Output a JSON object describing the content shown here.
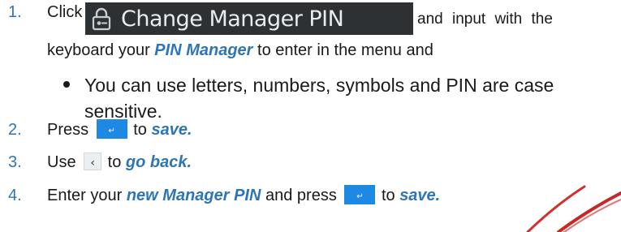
{
  "colors": {
    "accent_blue": "#2e75b6",
    "enter_button": "#1e88e5",
    "dark_button": "#2d3134",
    "red_mark": "#d32f2f"
  },
  "step1": {
    "number": "1.",
    "click_word": "Click",
    "button_label": "Change Manager PIN",
    "button_icon": "lock-icon",
    "tail": "and input with the",
    "line2_pre": "keyboard your ",
    "line2_em": "PIN Manager",
    "line2_post": " to enter in the menu and",
    "bullet": "You can use letters, numbers, symbols and PIN are case sensitive."
  },
  "step2": {
    "number": "2.",
    "pre": "Press ",
    "button_glyph": "↵",
    "button_icon": "enter-icon",
    "mid": " to ",
    "em": "save."
  },
  "step3": {
    "number": "3.",
    "pre": "Use ",
    "button_glyph": "‹",
    "button_icon": "back-arrow-icon",
    "mid": " to ",
    "em": "go back."
  },
  "step4": {
    "number": "4.",
    "pre": "Enter your ",
    "em1": "new Manager PIN",
    "mid": " and press ",
    "button_glyph": "↵",
    "button_icon": "enter-icon",
    "mid2": " to ",
    "em2": "save."
  }
}
